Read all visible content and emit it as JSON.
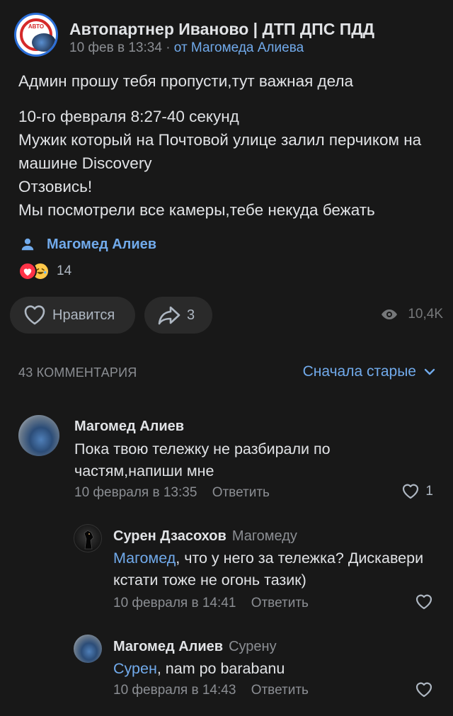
{
  "post": {
    "group_name": "Автопартнер Иваново | ДТП ДПС ПДД",
    "group_avatar_text": "АВТО",
    "date": "10 фев в 13:34",
    "separator": "·",
    "from_label": "от Магомеда Алиева",
    "paragraphs": [
      "Админ прошу тебя пропусти,тут важная дела",
      "10-го февраля 8:27-40 секунд\nМужик который на Почтовой улице залил перчиком на машине Discovery\nОтзовись!\nМы посмотрели все камеры,тебе некуда бежать"
    ],
    "signer": "Магомед Алиев",
    "reactions_count": "14",
    "like_label": "Нравится",
    "share_count": "3",
    "views": "10,4K"
  },
  "comments_section": {
    "count_label": "43 КОММЕНТАРИЯ",
    "sort_label": "Сначала старые"
  },
  "comments": [
    {
      "author": "Магомед Алиев",
      "reply_to": "",
      "mention": "",
      "text": "Пока твою тележку не разбирали по частям,напиши мне",
      "date": "10 февраля в 13:35",
      "reply_label": "Ответить",
      "likes": "1"
    },
    {
      "author": "Сурен Дзасохов",
      "reply_to": "Магомеду",
      "mention": "Магомед",
      "text": ", что у него за тележка? Дискавери кстати тоже не огонь тазик)",
      "date": "10 февраля в 14:41",
      "reply_label": "Ответить",
      "likes": ""
    },
    {
      "author": "Магомед Алиев",
      "reply_to": "Сурену",
      "mention": "Сурен",
      "text": ", nam po barabanu",
      "date": "10 февраля в 14:43",
      "reply_label": "Ответить",
      "likes": ""
    }
  ],
  "icons": {
    "signer": "person-icon",
    "like": "heart-outline-icon",
    "share": "share-arrow-icon",
    "views": "eye-icon",
    "sort": "chevron-down-icon"
  },
  "colors": {
    "background": "#181818",
    "accent": "#71aaeb",
    "text": "#e1e3e6",
    "secondary": "#8b8e93",
    "button_bg": "#2a2a2a",
    "heart_reaction": "#ff3347"
  }
}
